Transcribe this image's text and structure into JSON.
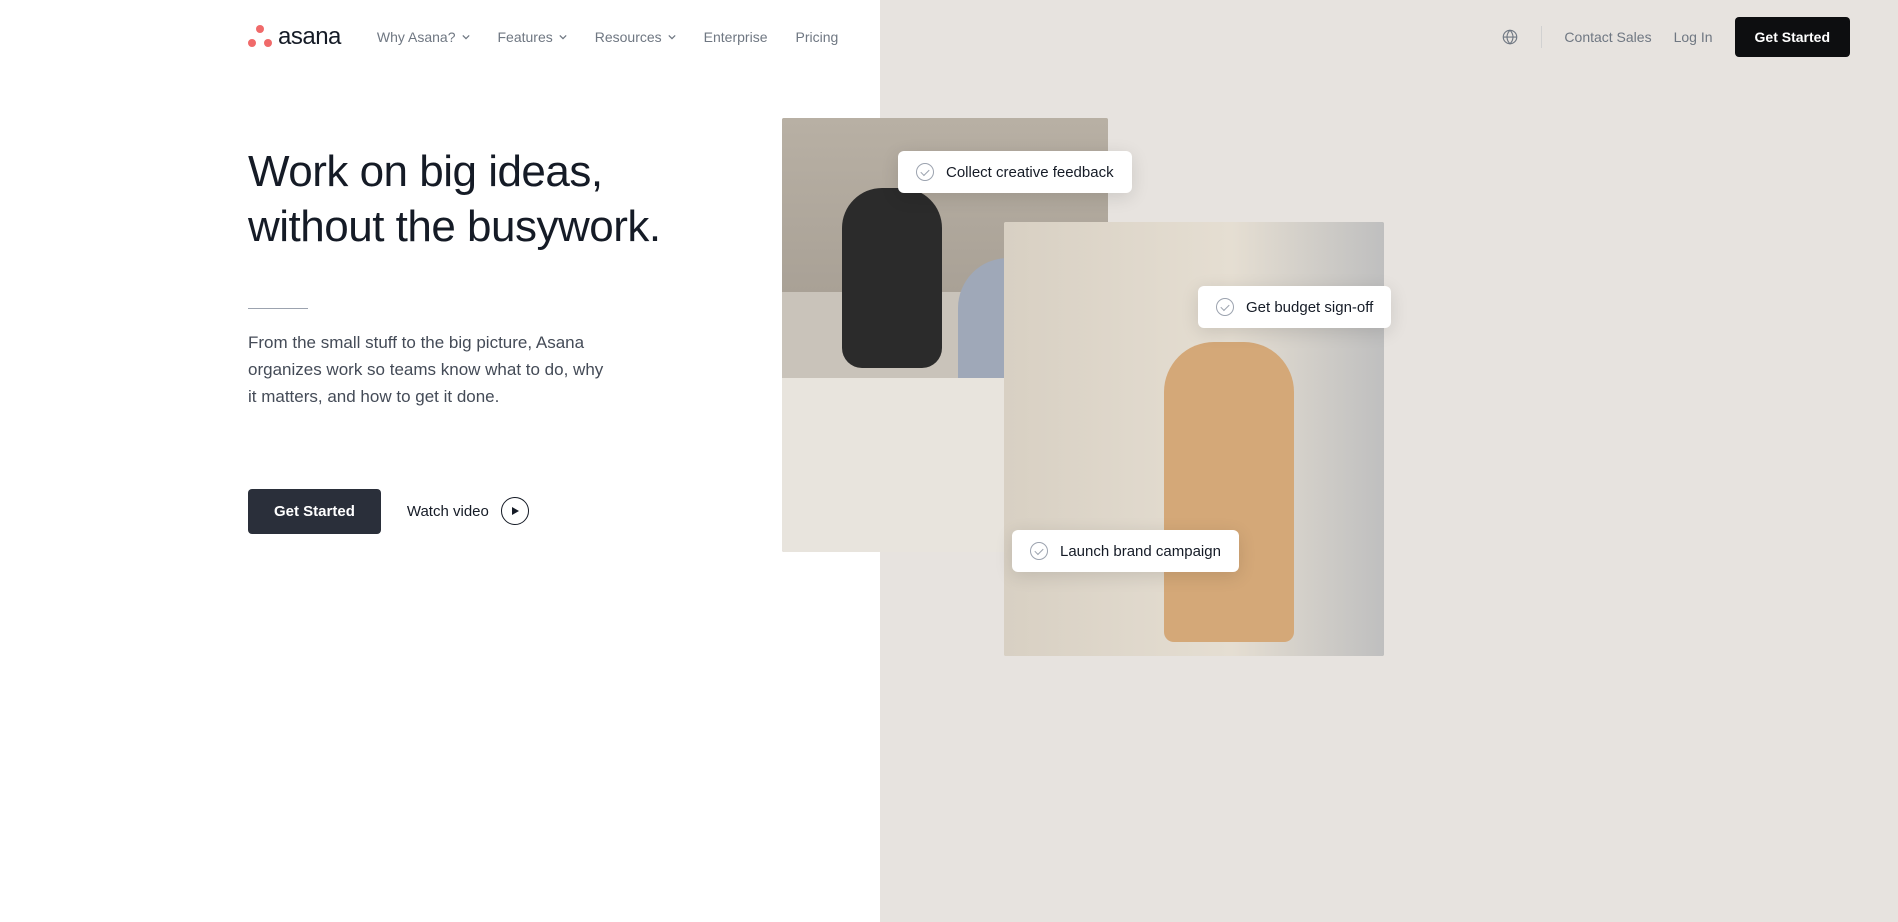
{
  "brand": {
    "name": "asana"
  },
  "nav": {
    "items": [
      {
        "label": "Why Asana?",
        "dropdown": true
      },
      {
        "label": "Features",
        "dropdown": true
      },
      {
        "label": "Resources",
        "dropdown": true
      },
      {
        "label": "Enterprise",
        "dropdown": false
      },
      {
        "label": "Pricing",
        "dropdown": false
      }
    ],
    "contact": "Contact Sales",
    "login": "Log In",
    "cta": "Get Started"
  },
  "hero": {
    "headline_l1": "Work on big ideas,",
    "headline_l2": "without the busywork.",
    "subhead": "From the small stuff to the big picture, Asana organizes work so teams know what to do, why it matters, and how to get it done.",
    "cta": "Get Started",
    "watch": "Watch video"
  },
  "chips": [
    "Collect creative feedback",
    "Get budget sign-off",
    "Launch brand campaign"
  ],
  "colors": {
    "accent": "#f06a6a",
    "bg_split": "#e7e3df",
    "text": "#151b26",
    "muted": "#6f7782",
    "btn_dark": "#2a2f3a"
  }
}
